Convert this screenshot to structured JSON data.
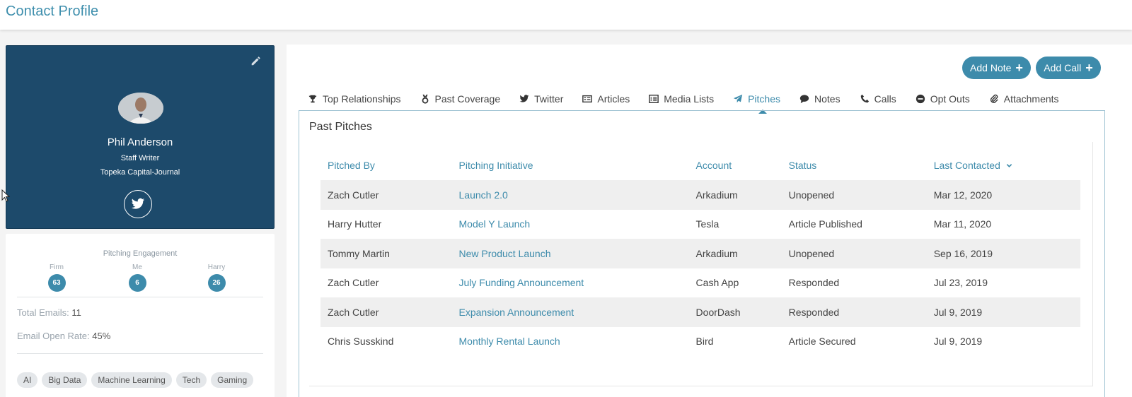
{
  "page": {
    "title": "Contact Profile"
  },
  "profile": {
    "name": "Phil Anderson",
    "role": "Staff Writer",
    "company": "Topeka Capital-Journal"
  },
  "engagement": {
    "title": "Pitching Engagement",
    "items": [
      {
        "label": "Firm",
        "value": "63"
      },
      {
        "label": "Me",
        "value": "6"
      },
      {
        "label": "Harry",
        "value": "26"
      }
    ]
  },
  "stats": {
    "total_emails_label": "Total Emails:",
    "total_emails_value": "11",
    "open_rate_label": "Email Open Rate:",
    "open_rate_value": "45%"
  },
  "tags": [
    "AI",
    "Big Data",
    "Machine Learning",
    "Tech",
    "Gaming"
  ],
  "actions": {
    "add_note": "Add Note",
    "add_call": "Add Call"
  },
  "tabs": [
    {
      "label": "Top Relationships",
      "icon": "trophy-icon"
    },
    {
      "label": "Past Coverage",
      "icon": "medal-icon"
    },
    {
      "label": "Twitter",
      "icon": "twitter-icon"
    },
    {
      "label": "Articles",
      "icon": "articles-icon"
    },
    {
      "label": "Media Lists",
      "icon": "list-icon"
    },
    {
      "label": "Pitches",
      "icon": "paper-plane-icon",
      "active": true
    },
    {
      "label": "Notes",
      "icon": "comment-icon"
    },
    {
      "label": "Calls",
      "icon": "phone-icon"
    },
    {
      "label": "Opt Outs",
      "icon": "minus-circle-icon"
    },
    {
      "label": "Attachments",
      "icon": "paperclip-icon"
    }
  ],
  "pitches": {
    "title": "Past Pitches",
    "columns": [
      "Pitched By",
      "Pitching Initiative",
      "Account",
      "Status",
      "Last Contacted"
    ],
    "rows": [
      [
        "Zach Cutler",
        "Launch 2.0",
        "Arkadium",
        "Unopened",
        "Mar 12, 2020"
      ],
      [
        "Harry Hutter",
        "Model Y Launch",
        "Tesla",
        "Article Published",
        "Mar 11, 2020"
      ],
      [
        "Tommy Martin",
        "New Product Launch",
        "Arkadium",
        "Unopened",
        "Sep 16, 2019"
      ],
      [
        "Zach Cutler",
        "July Funding Announcement",
        "Cash App",
        "Responded",
        "Jul 23, 2019"
      ],
      [
        "Zach Cutler",
        "Expansion Announcement",
        "DoorDash",
        "Responded",
        "Jul 9, 2019"
      ],
      [
        "Chris Susskind",
        "Monthly Rental Launch",
        "Bird",
        "Article Secured",
        "Jul 9, 2019"
      ]
    ]
  },
  "colors": {
    "accent": "#3d8bab",
    "profile_bg": "#1d4a6b"
  }
}
